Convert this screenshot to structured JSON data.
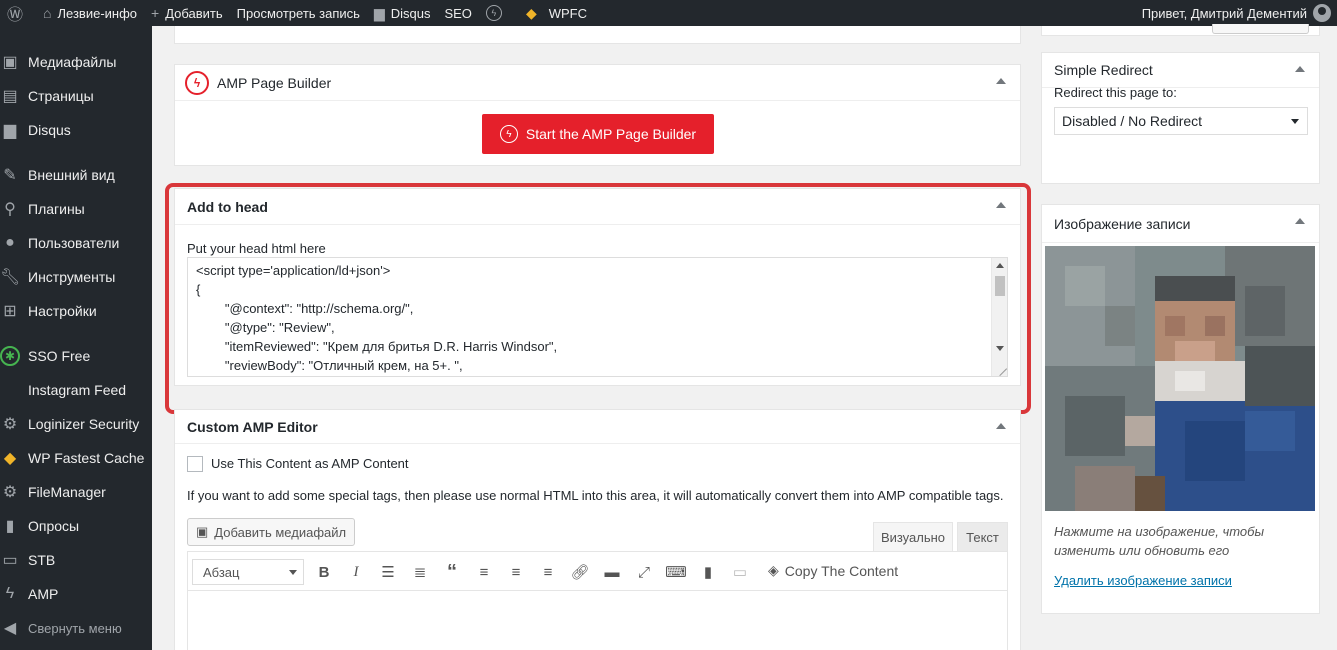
{
  "adminbar": {
    "site_name": "Лезвие-инфо",
    "add_new": "Добавить",
    "view_post": "Просмотреть запись",
    "disqus": "Disqus",
    "seo": "SEO",
    "wpfc": "WPFC",
    "greeting": "Привет, Дмитрий Дементий"
  },
  "sidebar": {
    "items": [
      {
        "label": "Медиафайлы",
        "icon": "media-icon"
      },
      {
        "label": "Страницы",
        "icon": "pages-icon"
      },
      {
        "label": "Disqus",
        "icon": "comment-icon"
      },
      {
        "label": "Внешний вид",
        "icon": "brush-icon"
      },
      {
        "label": "Плагины",
        "icon": "plugin-icon"
      },
      {
        "label": "Пользователи",
        "icon": "users-icon"
      },
      {
        "label": "Инструменты",
        "icon": "wrench-icon"
      },
      {
        "label": "Настройки",
        "icon": "settings-icon"
      },
      {
        "label": "SSO Free",
        "icon": "sso-icon"
      },
      {
        "label": "Instagram Feed",
        "icon": "instagram-icon"
      },
      {
        "label": "Loginizer Security",
        "icon": "gear-icon"
      },
      {
        "label": "WP Fastest Cache",
        "icon": "cheetah-icon"
      },
      {
        "label": "FileManager",
        "icon": "gear-icon"
      },
      {
        "label": "Опросы",
        "icon": "chart-icon"
      },
      {
        "label": "STB",
        "icon": "box-icon"
      },
      {
        "label": "AMP",
        "icon": "amp-icon"
      }
    ],
    "collapse_label": "Свернуть меню"
  },
  "amp_builder": {
    "title": "AMP Page Builder",
    "button_label": "Start the AMP Page Builder"
  },
  "add_to_head": {
    "title": "Add to head",
    "field_label": "Put your head html here",
    "code_lines": [
      "<script type='application/ld+json'>",
      "{",
      "        \"@context\": \"http://schema.org/\",",
      "        \"@type\": \"Review\",",
      "        \"itemReviewed\": \"Крем для бритья D.R. Harris Windsor\",",
      "        \"reviewBody\": \"Отличный крем, на 5+. \","
    ]
  },
  "custom_amp_editor": {
    "title": "Custom AMP Editor",
    "checkbox_label": "Use This Content as AMP Content",
    "info": "If you want to add some special tags, then please use normal HTML into this area, it will automatically convert them into AMP compatible tags.",
    "add_media": "Добавить медиафайл",
    "tab_visual": "Визуально",
    "tab_text": "Текст",
    "format_select": "Абзац",
    "copy_content": "Copy The Content"
  },
  "simple_redirect": {
    "title": "Simple Redirect",
    "label": "Redirect this page to:",
    "selected": "Disabled / No Redirect"
  },
  "featured_image": {
    "title": "Изображение записи",
    "hint": "Нажмите на изображение, чтобы изменить или обновить его",
    "remove_link": "Удалить изображение записи"
  },
  "colors": {
    "amp_red": "#e5202b",
    "highlight_red": "#d9373a",
    "admin_dark": "#23282d",
    "link_blue": "#0073aa"
  }
}
